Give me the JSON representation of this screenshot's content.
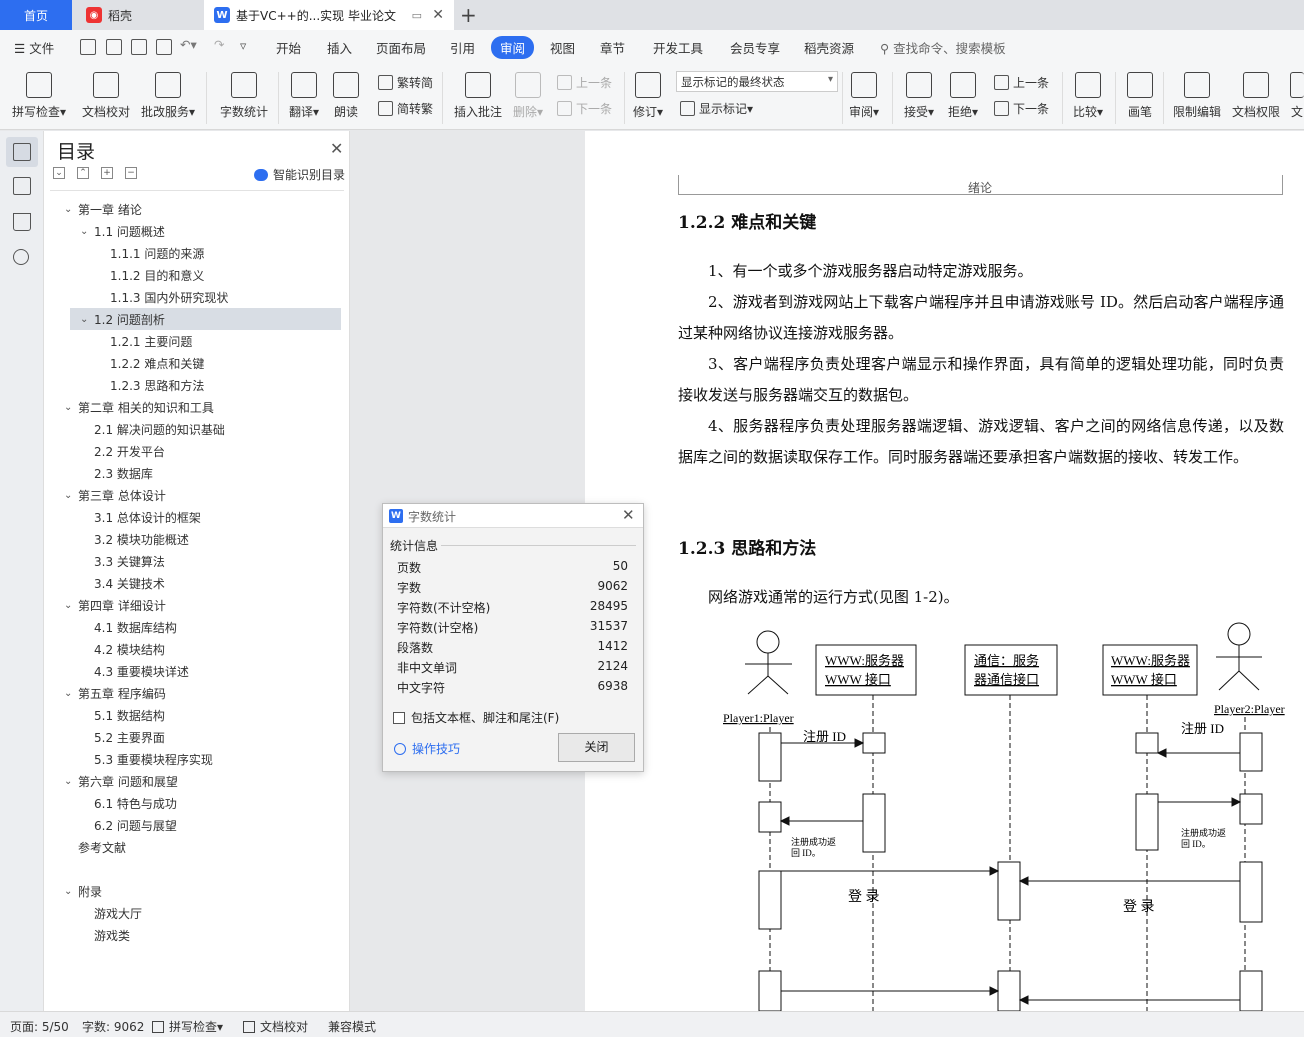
{
  "tabs": {
    "home": "首页",
    "daoke": "稻壳",
    "doc": "基于VC++的...实现 毕业论文"
  },
  "menu": {
    "file": "文件",
    "items": [
      "开始",
      "插入",
      "页面布局",
      "引用",
      "审阅",
      "视图",
      "章节",
      "开发工具",
      "会员专享",
      "稻壳资源"
    ],
    "active": "审阅",
    "search": "查找命令、搜索模板"
  },
  "ribbon": {
    "spell_check": "拼写检查",
    "doc_proof": "文档校对",
    "batch_service": "批改服务",
    "word_count": "字数统计",
    "translate": "翻译",
    "read_aloud": "朗读",
    "trad_to_simp": "繁转简",
    "simp_to_trad": "简转繁",
    "insert_comment": "插入批注",
    "delete": "删除",
    "prev_comment": "上一条",
    "next_comment": "下一条",
    "revise": "修订",
    "markup_combo": "显示标记的最终状态",
    "show_markup": "显示标记",
    "review": "审阅",
    "accept": "接受",
    "reject": "拒绝",
    "prev_change": "上一条",
    "next_change": "下一条",
    "compare": "比较",
    "pen": "画笔",
    "restrict_edit": "限制编辑",
    "doc_permission": "文档权限",
    "cut_off": "文"
  },
  "toc": {
    "title": "目录",
    "smart": "智能识别目录",
    "items": [
      {
        "label": "第一章  绪论",
        "level": 0,
        "toggle": "open"
      },
      {
        "label": "1.1  问题概述",
        "level": 1,
        "toggle": "open"
      },
      {
        "label": "1.1.1  问题的来源",
        "level": 2
      },
      {
        "label": "1.1.2  目的和意义",
        "level": 2
      },
      {
        "label": "1.1.3  国内外研究现状",
        "level": 2
      },
      {
        "label": "1.2  问题剖析",
        "level": 1,
        "toggle": "open",
        "selected": true
      },
      {
        "label": "1.2.1  主要问题",
        "level": 2
      },
      {
        "label": "1.2.2  难点和关键",
        "level": 2
      },
      {
        "label": "1.2.3  思路和方法",
        "level": 2
      },
      {
        "label": "第二章  相关的知识和工具",
        "level": 0,
        "toggle": "open"
      },
      {
        "label": "2.1  解决问题的知识基础",
        "level": 1
      },
      {
        "label": "2.2  开发平台",
        "level": 1
      },
      {
        "label": "2.3  数据库",
        "level": 1
      },
      {
        "label": "第三章  总体设计",
        "level": 0,
        "toggle": "open"
      },
      {
        "label": "3.1  总体设计的框架",
        "level": 1
      },
      {
        "label": "3.2  模块功能概述",
        "level": 1
      },
      {
        "label": "3.3  关键算法",
        "level": 1
      },
      {
        "label": "3.4 关键技术",
        "level": 1
      },
      {
        "label": "第四章  详细设计",
        "level": 0,
        "toggle": "open"
      },
      {
        "label": "4.1 数据库结构",
        "level": 1
      },
      {
        "label": "4.2 模块结构",
        "level": 1
      },
      {
        "label": "4.3  重要模块详述",
        "level": 1
      },
      {
        "label": "第五章  程序编码",
        "level": 0,
        "toggle": "open"
      },
      {
        "label": "5.1  数据结构",
        "level": 1
      },
      {
        "label": "5.2 主要界面",
        "level": 1
      },
      {
        "label": "5.3  重要模块程序实现",
        "level": 1
      },
      {
        "label": "第六章  问题和展望",
        "level": 0,
        "toggle": "open"
      },
      {
        "label": "6.1  特色与成功",
        "level": 1
      },
      {
        "label": "6.2  问题与展望",
        "level": 1
      },
      {
        "label": "参考文献",
        "level": 0
      },
      {
        "label": "",
        "level": 0
      },
      {
        "label": "附录",
        "level": 0,
        "toggle": "open"
      },
      {
        "label": "游戏大厅",
        "level": 1
      },
      {
        "label": "游戏类",
        "level": 1
      }
    ]
  },
  "document": {
    "header": "绪论",
    "h_122": "1.2.2  难点和关键",
    "p1": "1、有一个或多个游戏服务器启动特定游戏服务。",
    "p2": "2、游戏者到游戏网站上下载客户端程序并且申请游戏账号 ID。然后启动客户端程序通过某种网络协议连接游戏服务器。",
    "p3": "3、客户端程序负责处理客户端显示和操作界面，具有简单的逻辑处理功能，同时负责接收发送与服务器端交互的数据包。",
    "p4": "4、服务器程序负责处理服务器端逻辑、游戏逻辑、客户之间的网络信息传递，以及数据库之间的数据读取保存工作。同时服务器端还要承担客户端数据的接收、转发工作。",
    "h_123": "1.2.3  思路和方法",
    "p5": "网络游戏通常的运行方式(见图 1-2)。",
    "diagram": {
      "box1_l1": "WWW:服务器",
      "box1_l2": "WWW 接口",
      "box2_l1": "通信：服务",
      "box2_l2": "器通信接口",
      "box3_l1": "WWW:服务器",
      "box3_l2": "WWW 接口",
      "player1": "Player1:Player",
      "player2": "Player2:Player",
      "register1": "注册  ID",
      "register2": "注册  ID",
      "reg_ok1_l1": "注册成功返",
      "reg_ok1_l2": "回 ID。",
      "reg_ok2_l1": "注册成功返",
      "reg_ok2_l2": "回 ID。",
      "login1": "登  录",
      "login2": "登  录"
    }
  },
  "dialog": {
    "title": "字数统计",
    "section": "统计信息",
    "stats": [
      {
        "label": "页数",
        "value": "50"
      },
      {
        "label": "字数",
        "value": "9062"
      },
      {
        "label": "字符数(不计空格)",
        "value": "28495"
      },
      {
        "label": "字符数(计空格)",
        "value": "31537"
      },
      {
        "label": "段落数",
        "value": "1412"
      },
      {
        "label": "非中文单词",
        "value": "2124"
      },
      {
        "label": "中文字符",
        "value": "6938"
      }
    ],
    "checkbox": "包括文本框、脚注和尾注(F)",
    "tips": "操作技巧",
    "close": "关闭"
  },
  "status": {
    "page": "页面: 5/50",
    "words": "字数: 9062",
    "spell": "拼写检查",
    "proof": "文档校对",
    "compat": "兼容模式"
  },
  "colors": {
    "accent": "#2d6ef0",
    "selection": "#d8dde4"
  }
}
